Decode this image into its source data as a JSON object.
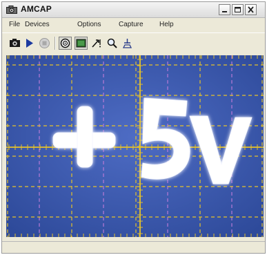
{
  "window": {
    "title": "AMCAP"
  },
  "menu": {
    "items": [
      "File",
      "Devices",
      "Options",
      "Capture",
      "Help"
    ]
  },
  "toolbar": {
    "icons": [
      "camera-icon",
      "play-icon",
      "stop-icon",
      "record-icon",
      "capture-window-icon",
      "pointer-icon",
      "zoom-icon",
      "properties-icon"
    ]
  },
  "preview": {
    "overlay_text": "+5V",
    "grid_color": "#e6c229",
    "tick_color_alt": "#b87ad6",
    "background_color": "#3a57ab"
  },
  "status": {
    "text": ""
  }
}
